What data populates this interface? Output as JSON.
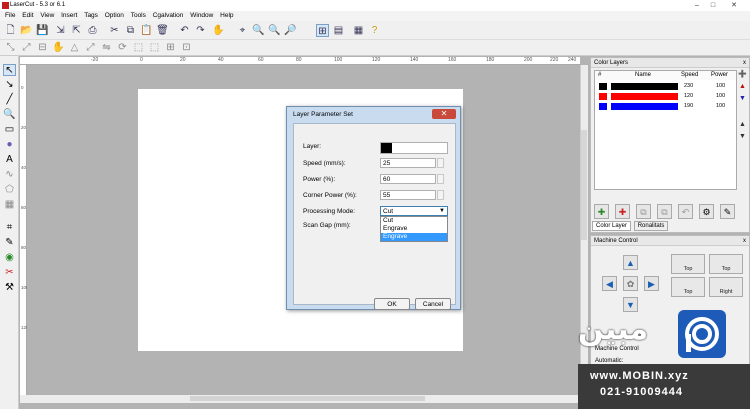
{
  "app": {
    "title": "LaserCut - 5.3 or 6.1",
    "window_controls": [
      "–",
      "□",
      "✕"
    ]
  },
  "menu": [
    "File",
    "Edit",
    "View",
    "Insert",
    "Tags",
    "Option",
    "Tools",
    "Cgalvation",
    "Window",
    "Help"
  ],
  "rulers": {
    "horizontal_labels": [
      "-20",
      "0",
      "20",
      "40",
      "60",
      "80",
      "100",
      "120",
      "140",
      "160",
      "180",
      "200",
      "220",
      "240"
    ],
    "vertical_labels": [
      "0",
      "20",
      "40",
      "60",
      "80",
      "100",
      "120"
    ]
  },
  "color_layers": {
    "title": "Color Layers",
    "close": "x",
    "columns": [
      "#",
      "Name",
      "Speed",
      "Power"
    ],
    "rows": [
      {
        "swatch": "#000000",
        "bar": "#000000",
        "speed": "230",
        "power": "100"
      },
      {
        "swatch": "#ff0000",
        "bar": "#ff0000",
        "speed": "120",
        "power": "100"
      },
      {
        "swatch": "#0000ff",
        "bar": "#0000ff",
        "speed": "190",
        "power": "100"
      }
    ],
    "tabs": [
      "Color Layer",
      "Ronalitats"
    ]
  },
  "machine_control": {
    "title": "Machine Control",
    "close": "x",
    "buttons": [
      "Top",
      "Top",
      "Top",
      "Right"
    ],
    "labels": [
      "Machine Control",
      "Automatic:"
    ]
  },
  "dialog": {
    "title": "Layer Parameter Set",
    "close": "✕",
    "fields": {
      "layer_label": "Layer:",
      "speed_label": "Speed (mm/s):",
      "speed_value": "25",
      "power_label": "Power (%):",
      "power_value": "60",
      "corner_label": "Corner Power (%):",
      "corner_value": "55",
      "mode_label": "Processing Mode:",
      "mode_value": "Cut",
      "scan_label": "Scan Gap (mm):"
    },
    "mode_options": [
      "Cut",
      "Engrave",
      "Engrave"
    ],
    "ok": "OK",
    "cancel": "Cancel"
  },
  "watermark": {
    "brand": "مبین",
    "url": "www.MOBIN.xyz",
    "phone": "021-91009444"
  }
}
